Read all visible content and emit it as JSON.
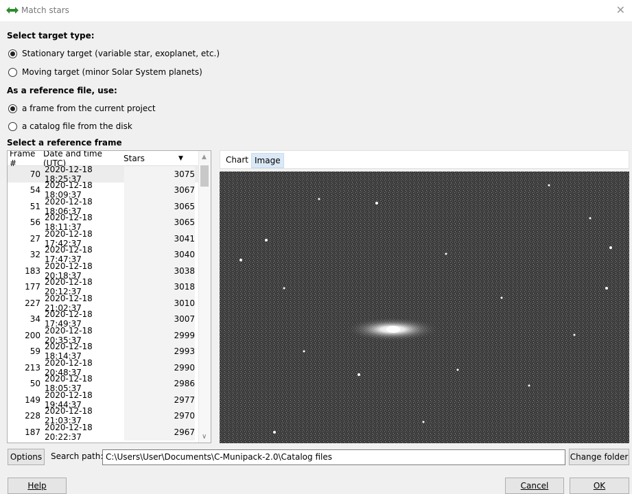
{
  "window": {
    "title": "Match stars",
    "close_glyph": "✕",
    "icon": "double-arrow-icon"
  },
  "target_type": {
    "label": "Select target type:",
    "options": [
      {
        "label": "Stationary target (variable star, exoplanet, etc.)",
        "checked": true
      },
      {
        "label": "Moving target (minor Solar System planets)",
        "checked": false
      }
    ]
  },
  "reference": {
    "label": "As a reference file, use:",
    "options": [
      {
        "label": "a frame from the current project",
        "checked": true
      },
      {
        "label": "a catalog file from the disk",
        "checked": false
      }
    ]
  },
  "frames": {
    "label": "Select a reference frame",
    "headers": [
      "Frame #",
      "Date and time (UTC)",
      "Stars"
    ],
    "sort_glyph": "▼",
    "rows": [
      {
        "frame": "70",
        "datetime": "2020-12-18 18:25:37",
        "stars": "3075"
      },
      {
        "frame": "54",
        "datetime": "2020-12-18 18:09:37",
        "stars": "3067"
      },
      {
        "frame": "51",
        "datetime": "2020-12-18 18:06:37",
        "stars": "3065"
      },
      {
        "frame": "56",
        "datetime": "2020-12-18 18:11:37",
        "stars": "3065"
      },
      {
        "frame": "27",
        "datetime": "2020-12-18 17:42:37",
        "stars": "3041"
      },
      {
        "frame": "32",
        "datetime": "2020-12-18 17:47:37",
        "stars": "3040"
      },
      {
        "frame": "183",
        "datetime": "2020-12-18 20:18:37",
        "stars": "3038"
      },
      {
        "frame": "177",
        "datetime": "2020-12-18 20:12:37",
        "stars": "3018"
      },
      {
        "frame": "227",
        "datetime": "2020-12-18 21:02:37",
        "stars": "3010"
      },
      {
        "frame": "34",
        "datetime": "2020-12-18 17:49:37",
        "stars": "3007"
      },
      {
        "frame": "200",
        "datetime": "2020-12-18 20:35:37",
        "stars": "2999"
      },
      {
        "frame": "59",
        "datetime": "2020-12-18 18:14:37",
        "stars": "2993"
      },
      {
        "frame": "213",
        "datetime": "2020-12-18 20:48:37",
        "stars": "2990"
      },
      {
        "frame": "50",
        "datetime": "2020-12-18 18:05:37",
        "stars": "2986"
      },
      {
        "frame": "149",
        "datetime": "2020-12-18 19:44:37",
        "stars": "2977"
      },
      {
        "frame": "228",
        "datetime": "2020-12-18 21:03:37",
        "stars": "2970"
      },
      {
        "frame": "187",
        "datetime": "2020-12-18 20:22:37",
        "stars": "2967"
      }
    ]
  },
  "preview": {
    "tabs": [
      {
        "label": "Chart",
        "active": false
      },
      {
        "label": "Image",
        "active": true
      }
    ]
  },
  "search": {
    "options_label": "Options",
    "path_label": "Search path:",
    "path_value": "C:\\Users\\User\\Documents\\C-Munipack-2.0\\Catalog files",
    "change_label": "Change folder"
  },
  "footer": {
    "help": "Help",
    "cancel": "Cancel",
    "ok": "OK"
  },
  "colors": {
    "accent": "#2e8b2e",
    "selected_tab": "#dbe9f7",
    "image_bg": "#3a3a3a"
  }
}
